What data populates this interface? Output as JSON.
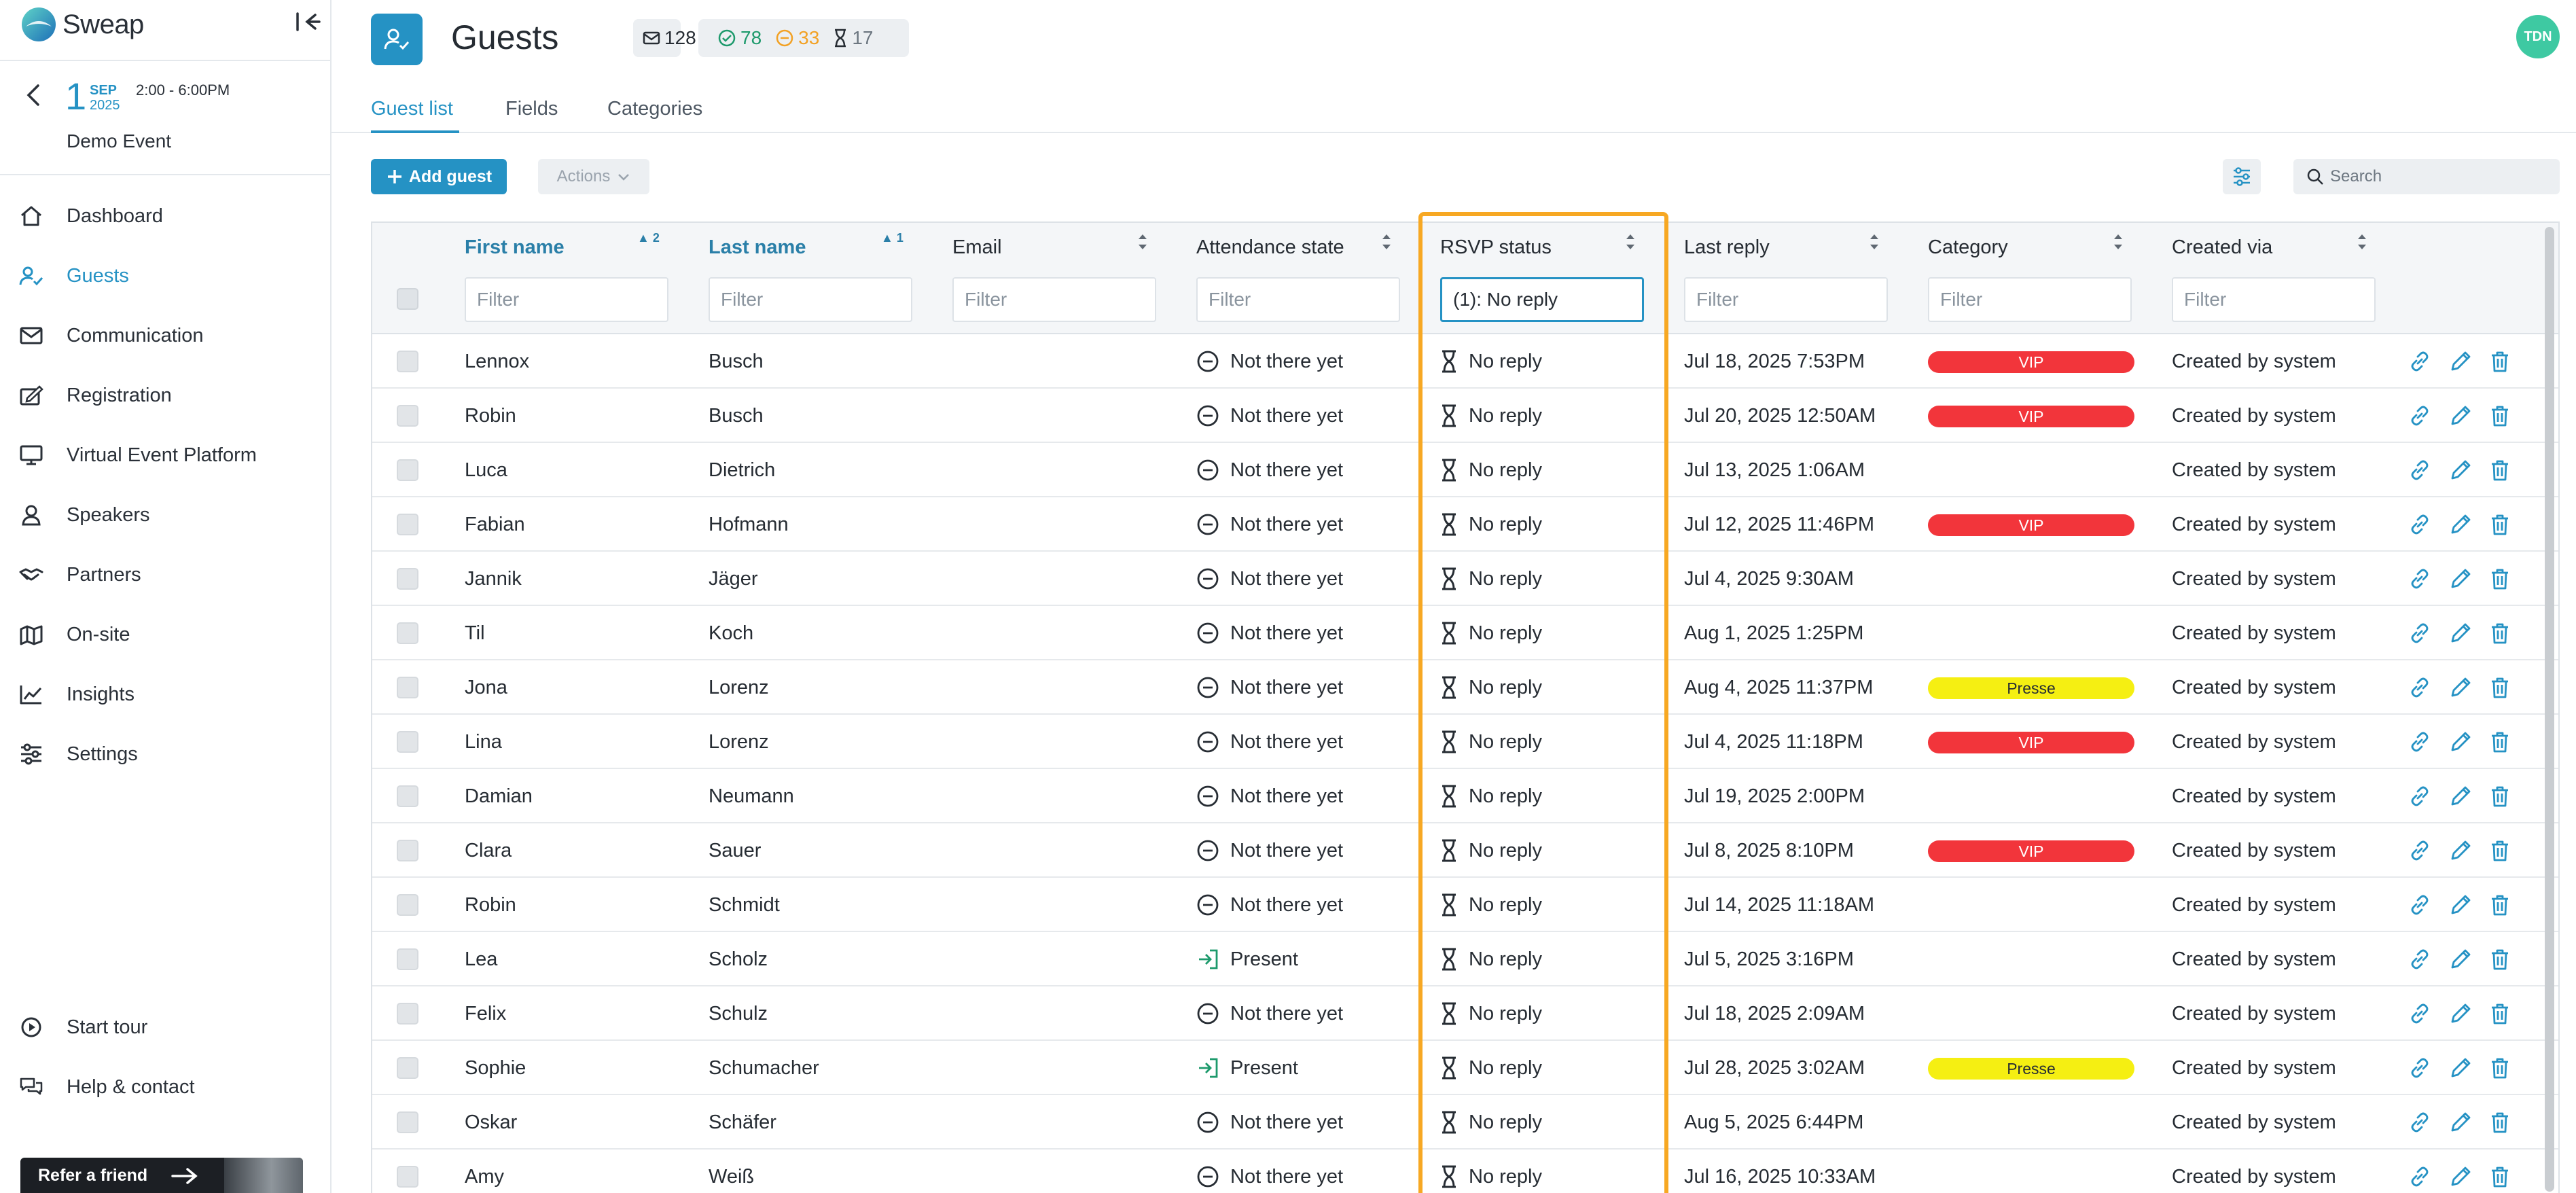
{
  "app": {
    "brand": "Sweap"
  },
  "event": {
    "day": "1",
    "month": "SEP",
    "year": "2025",
    "time": "2:00 - 6:00PM",
    "name": "Demo Event"
  },
  "sidebar": {
    "items": [
      {
        "label": "Dashboard",
        "icon": "home-icon"
      },
      {
        "label": "Guests",
        "icon": "guest-check-icon",
        "active": true
      },
      {
        "label": "Communication",
        "icon": "mail-icon"
      },
      {
        "label": "Registration",
        "icon": "registration-icon"
      },
      {
        "label": "Virtual Event Platform",
        "icon": "screen-icon"
      },
      {
        "label": "Speakers",
        "icon": "speaker-icon"
      },
      {
        "label": "Partners",
        "icon": "handshake-icon"
      },
      {
        "label": "On-site",
        "icon": "map-icon"
      },
      {
        "label": "Insights",
        "icon": "chart-icon"
      },
      {
        "label": "Settings",
        "icon": "sliders-icon"
      }
    ],
    "bottom": [
      {
        "label": "Start tour",
        "icon": "play-icon"
      },
      {
        "label": "Help & contact",
        "icon": "chat-icon"
      }
    ],
    "refer": "Refer a friend"
  },
  "header": {
    "title": "Guests",
    "invited": "128",
    "accepted": "78",
    "declined": "33",
    "pending": "17",
    "avatar": "TDN"
  },
  "tabs": [
    "Guest list",
    "Fields",
    "Categories"
  ],
  "toolbar": {
    "add_label": "Add guest",
    "actions_label": "Actions",
    "search_placeholder": "Search"
  },
  "colors": {
    "accent": "#2592c4",
    "vip": "#f2353b",
    "presse": "#f5ef12",
    "highlight": "#f7a823",
    "success": "#1d9a6c"
  },
  "table": {
    "columns": [
      {
        "label": "First name",
        "sorted": true,
        "rank": "2",
        "filter_placeholder": "Filter",
        "filter_value": ""
      },
      {
        "label": "Last name",
        "sorted": true,
        "rank": "1",
        "filter_placeholder": "Filter",
        "filter_value": ""
      },
      {
        "label": "Email",
        "filter_placeholder": "Filter",
        "filter_value": ""
      },
      {
        "label": "Attendance state",
        "filter_placeholder": "Filter",
        "filter_value": ""
      },
      {
        "label": "RSVP status",
        "filter_placeholder": "Filter",
        "filter_value": "(1): No reply"
      },
      {
        "label": "Last reply",
        "filter_placeholder": "Filter",
        "filter_value": ""
      },
      {
        "label": "Category",
        "filter_placeholder": "Filter",
        "filter_value": ""
      },
      {
        "label": "Created via",
        "filter_placeholder": "Filter",
        "filter_value": ""
      }
    ],
    "rows": [
      {
        "first": "Lennox",
        "last": "Busch",
        "email": "",
        "attendance": "Not there yet",
        "rsvp": "No reply",
        "last_reply": "Jul 18, 2025 7:53PM",
        "category": "VIP",
        "created": "Created by system"
      },
      {
        "first": "Robin",
        "last": "Busch",
        "email": "",
        "attendance": "Not there yet",
        "rsvp": "No reply",
        "last_reply": "Jul 20, 2025 12:50AM",
        "category": "VIP",
        "created": "Created by system"
      },
      {
        "first": "Luca",
        "last": "Dietrich",
        "email": "",
        "attendance": "Not there yet",
        "rsvp": "No reply",
        "last_reply": "Jul 13, 2025 1:06AM",
        "category": "",
        "created": "Created by system"
      },
      {
        "first": "Fabian",
        "last": "Hofmann",
        "email": "",
        "attendance": "Not there yet",
        "rsvp": "No reply",
        "last_reply": "Jul 12, 2025 11:46PM",
        "category": "VIP",
        "created": "Created by system"
      },
      {
        "first": "Jannik",
        "last": "Jäger",
        "email": "",
        "attendance": "Not there yet",
        "rsvp": "No reply",
        "last_reply": "Jul 4, 2025 9:30AM",
        "category": "",
        "created": "Created by system"
      },
      {
        "first": "Til",
        "last": "Koch",
        "email": "",
        "attendance": "Not there yet",
        "rsvp": "No reply",
        "last_reply": "Aug 1, 2025 1:25PM",
        "category": "",
        "created": "Created by system"
      },
      {
        "first": "Jona",
        "last": "Lorenz",
        "email": "",
        "attendance": "Not there yet",
        "rsvp": "No reply",
        "last_reply": "Aug 4, 2025 11:37PM",
        "category": "Presse",
        "created": "Created by system"
      },
      {
        "first": "Lina",
        "last": "Lorenz",
        "email": "",
        "attendance": "Not there yet",
        "rsvp": "No reply",
        "last_reply": "Jul 4, 2025 11:18PM",
        "category": "VIP",
        "created": "Created by system"
      },
      {
        "first": "Damian",
        "last": "Neumann",
        "email": "",
        "attendance": "Not there yet",
        "rsvp": "No reply",
        "last_reply": "Jul 19, 2025 2:00PM",
        "category": "",
        "created": "Created by system"
      },
      {
        "first": "Clara",
        "last": "Sauer",
        "email": "",
        "attendance": "Not there yet",
        "rsvp": "No reply",
        "last_reply": "Jul 8, 2025 8:10PM",
        "category": "VIP",
        "created": "Created by system"
      },
      {
        "first": "Robin",
        "last": "Schmidt",
        "email": "",
        "attendance": "Not there yet",
        "rsvp": "No reply",
        "last_reply": "Jul 14, 2025 11:18AM",
        "category": "",
        "created": "Created by system"
      },
      {
        "first": "Lea",
        "last": "Scholz",
        "email": "",
        "attendance": "Present",
        "rsvp": "No reply",
        "last_reply": "Jul 5, 2025 3:16PM",
        "category": "",
        "created": "Created by system"
      },
      {
        "first": "Felix",
        "last": "Schulz",
        "email": "",
        "attendance": "Not there yet",
        "rsvp": "No reply",
        "last_reply": "Jul 18, 2025 2:09AM",
        "category": "",
        "created": "Created by system"
      },
      {
        "first": "Sophie",
        "last": "Schumacher",
        "email": "",
        "attendance": "Present",
        "rsvp": "No reply",
        "last_reply": "Jul 28, 2025 3:02AM",
        "category": "Presse",
        "created": "Created by system"
      },
      {
        "first": "Oskar",
        "last": "Schäfer",
        "email": "",
        "attendance": "Not there yet",
        "rsvp": "No reply",
        "last_reply": "Aug 5, 2025 6:44PM",
        "category": "",
        "created": "Created by system"
      },
      {
        "first": "Amy",
        "last": "Weiß",
        "email": "",
        "attendance": "Not there yet",
        "rsvp": "No reply",
        "last_reply": "Jul 16, 2025 10:33AM",
        "category": "",
        "created": "Created by system"
      }
    ]
  }
}
